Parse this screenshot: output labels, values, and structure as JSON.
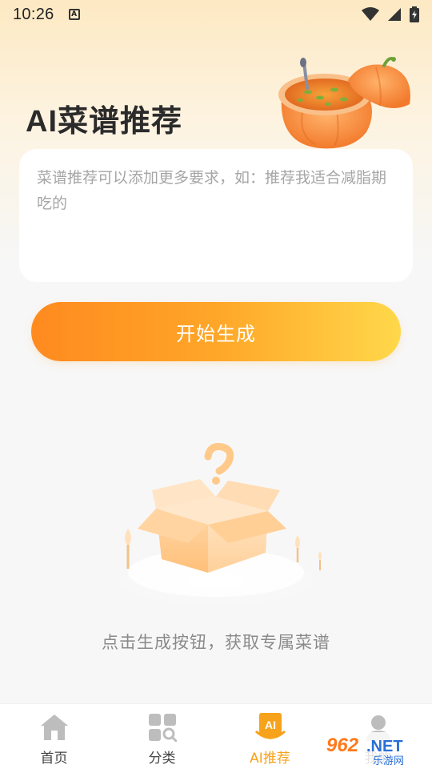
{
  "status_bar": {
    "time": "10:26"
  },
  "page_title": "AI菜谱推荐",
  "input": {
    "value": "",
    "placeholder": "菜谱推荐可以添加更多要求，如：推荐我适合减脂期吃的"
  },
  "generate_button": {
    "label": "开始生成"
  },
  "empty_state": {
    "text": "点击生成按钮，获取专属菜谱"
  },
  "tabs": [
    {
      "label": "首页",
      "icon": "home-icon",
      "active": false
    },
    {
      "label": "分类",
      "icon": "category-icon",
      "active": false
    },
    {
      "label": "AI推荐",
      "icon": "ai-icon",
      "active": true
    },
    {
      "label": "我的",
      "icon": "profile-icon",
      "active": false
    }
  ],
  "colors": {
    "accent": "#f7a21b",
    "button_start": "#ff8a1f",
    "button_end": "#ffd84a"
  },
  "watermark": {
    "logo_text": "962.NET",
    "sub_text": "乐游网"
  }
}
